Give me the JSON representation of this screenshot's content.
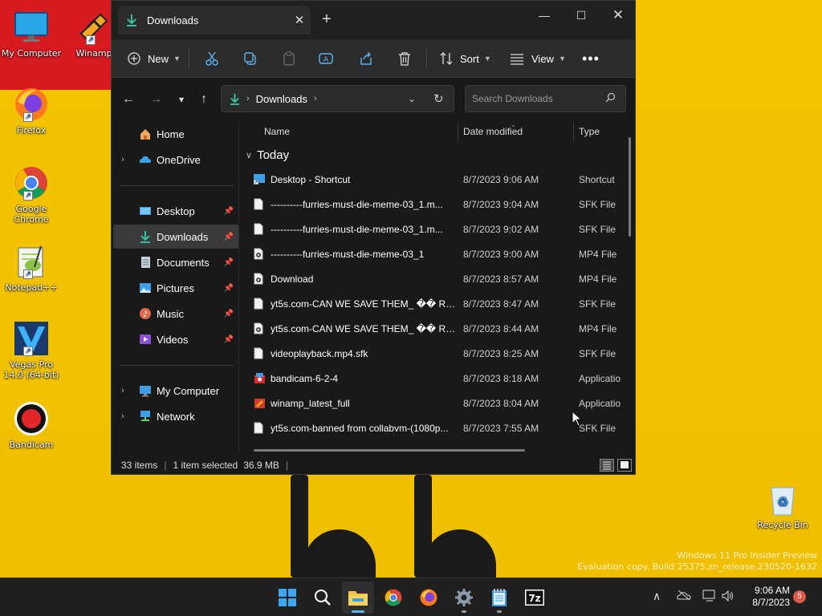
{
  "desktop": {
    "icons": [
      {
        "label": "My Computer"
      },
      {
        "label": "Winamp"
      },
      {
        "label": "Firefox"
      },
      {
        "label": "Google Chrome"
      },
      {
        "label": "Notepad++"
      },
      {
        "label": "Vegas Pro 14.0 (64-bit)"
      },
      {
        "label": "Bandicam"
      },
      {
        "label": "Recycle Bin"
      }
    ],
    "watermark": {
      "line1": "Windows 11 Pro Insider Preview",
      "line2": "Evaluation copy. Build 25375.zn_release.230520-1632"
    }
  },
  "window": {
    "tab_title": "Downloads",
    "toolbar": {
      "new_label": "New",
      "sort_label": "Sort",
      "view_label": "View"
    },
    "address": {
      "path": "Downloads"
    },
    "search": {
      "placeholder": "Search Downloads"
    },
    "nav": {
      "items": [
        {
          "label": "Home"
        },
        {
          "label": "OneDrive"
        },
        {
          "label": "Desktop"
        },
        {
          "label": "Downloads"
        },
        {
          "label": "Documents"
        },
        {
          "label": "Pictures"
        },
        {
          "label": "Music"
        },
        {
          "label": "Videos"
        },
        {
          "label": "My Computer"
        },
        {
          "label": "Network"
        }
      ]
    },
    "columns": {
      "name": "Name",
      "date": "Date modified",
      "type": "Type"
    },
    "group": "Today",
    "files": [
      {
        "name": "Desktop - Shortcut",
        "date": "8/7/2023 9:06 AM",
        "type": "Shortcut",
        "icon": "shortcut-icon"
      },
      {
        "name": "----------furries-must-die-meme-03_1.m...",
        "date": "8/7/2023 9:04 AM",
        "type": "SFK File",
        "icon": "file-icon"
      },
      {
        "name": "----------furries-must-die-meme-03_1.m...",
        "date": "8/7/2023 9:02 AM",
        "type": "SFK File",
        "icon": "file-icon"
      },
      {
        "name": "----------furries-must-die-meme-03_1",
        "date": "8/7/2023 9:00 AM",
        "type": "MP4 File",
        "icon": "video-file-icon"
      },
      {
        "name": "Download",
        "date": "8/7/2023 8:57 AM",
        "type": "MP4 File",
        "icon": "video-file-icon"
      },
      {
        "name": "yt5s.com-CAN WE SAVE THEM_ �� Rai...",
        "date": "8/7/2023 8:47 AM",
        "type": "SFK File",
        "icon": "file-icon"
      },
      {
        "name": "yt5s.com-CAN WE SAVE THEM_ �� Rai...",
        "date": "8/7/2023 8:44 AM",
        "type": "MP4 File",
        "icon": "video-file-icon"
      },
      {
        "name": "videoplayback.mp4.sfk",
        "date": "8/7/2023 8:25 AM",
        "type": "SFK File",
        "icon": "file-icon"
      },
      {
        "name": "bandicam-6-2-4",
        "date": "8/7/2023 8:18 AM",
        "type": "Applicatio",
        "icon": "installer-icon"
      },
      {
        "name": "winamp_latest_full",
        "date": "8/7/2023 8:04 AM",
        "type": "Applicatio",
        "icon": "installer-icon"
      },
      {
        "name": "yt5s.com-banned from collabvm-(1080p...",
        "date": "8/7/2023 7:55 AM",
        "type": "SFK File",
        "icon": "file-icon"
      }
    ],
    "status": {
      "items": "33 items",
      "selected": "1 item selected",
      "size": "36.9 MB"
    }
  },
  "taskbar": {
    "clock_time": "9:06 AM",
    "clock_date": "8/7/2023",
    "notifications": "5"
  }
}
